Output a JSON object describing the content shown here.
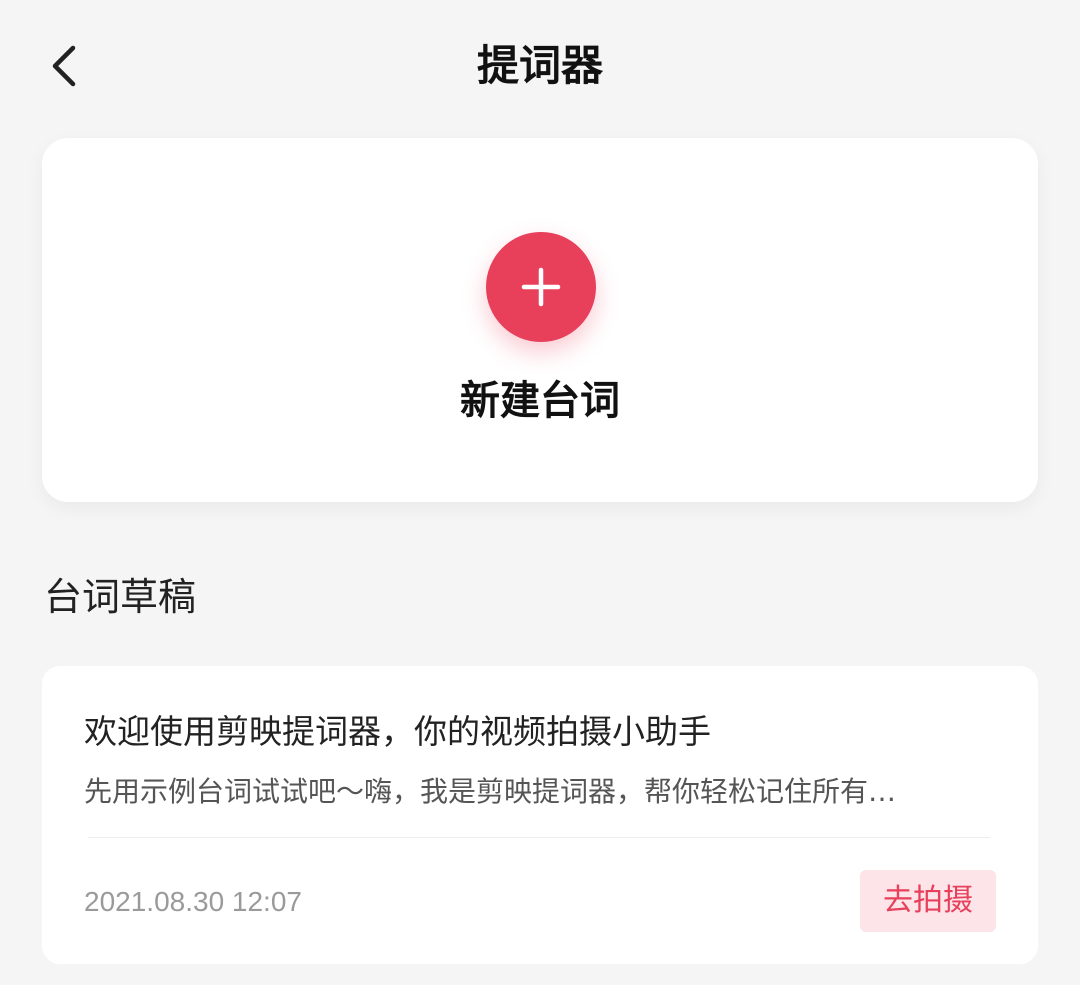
{
  "header": {
    "title": "提词器",
    "back_icon": "chevron-left-icon"
  },
  "create": {
    "icon": "plus-icon",
    "label": "新建台词",
    "accent_color": "#e8405b"
  },
  "drafts_section": {
    "title": "台词草稿",
    "items": [
      {
        "title": "欢迎使用剪映提词器，你的视频拍摄小助手",
        "preview": "先用示例台词试试吧～嗨，我是剪映提词器，帮你轻松记住所有…",
        "date": "2021.08.30 12:07",
        "action_label": "去拍摄"
      }
    ]
  }
}
